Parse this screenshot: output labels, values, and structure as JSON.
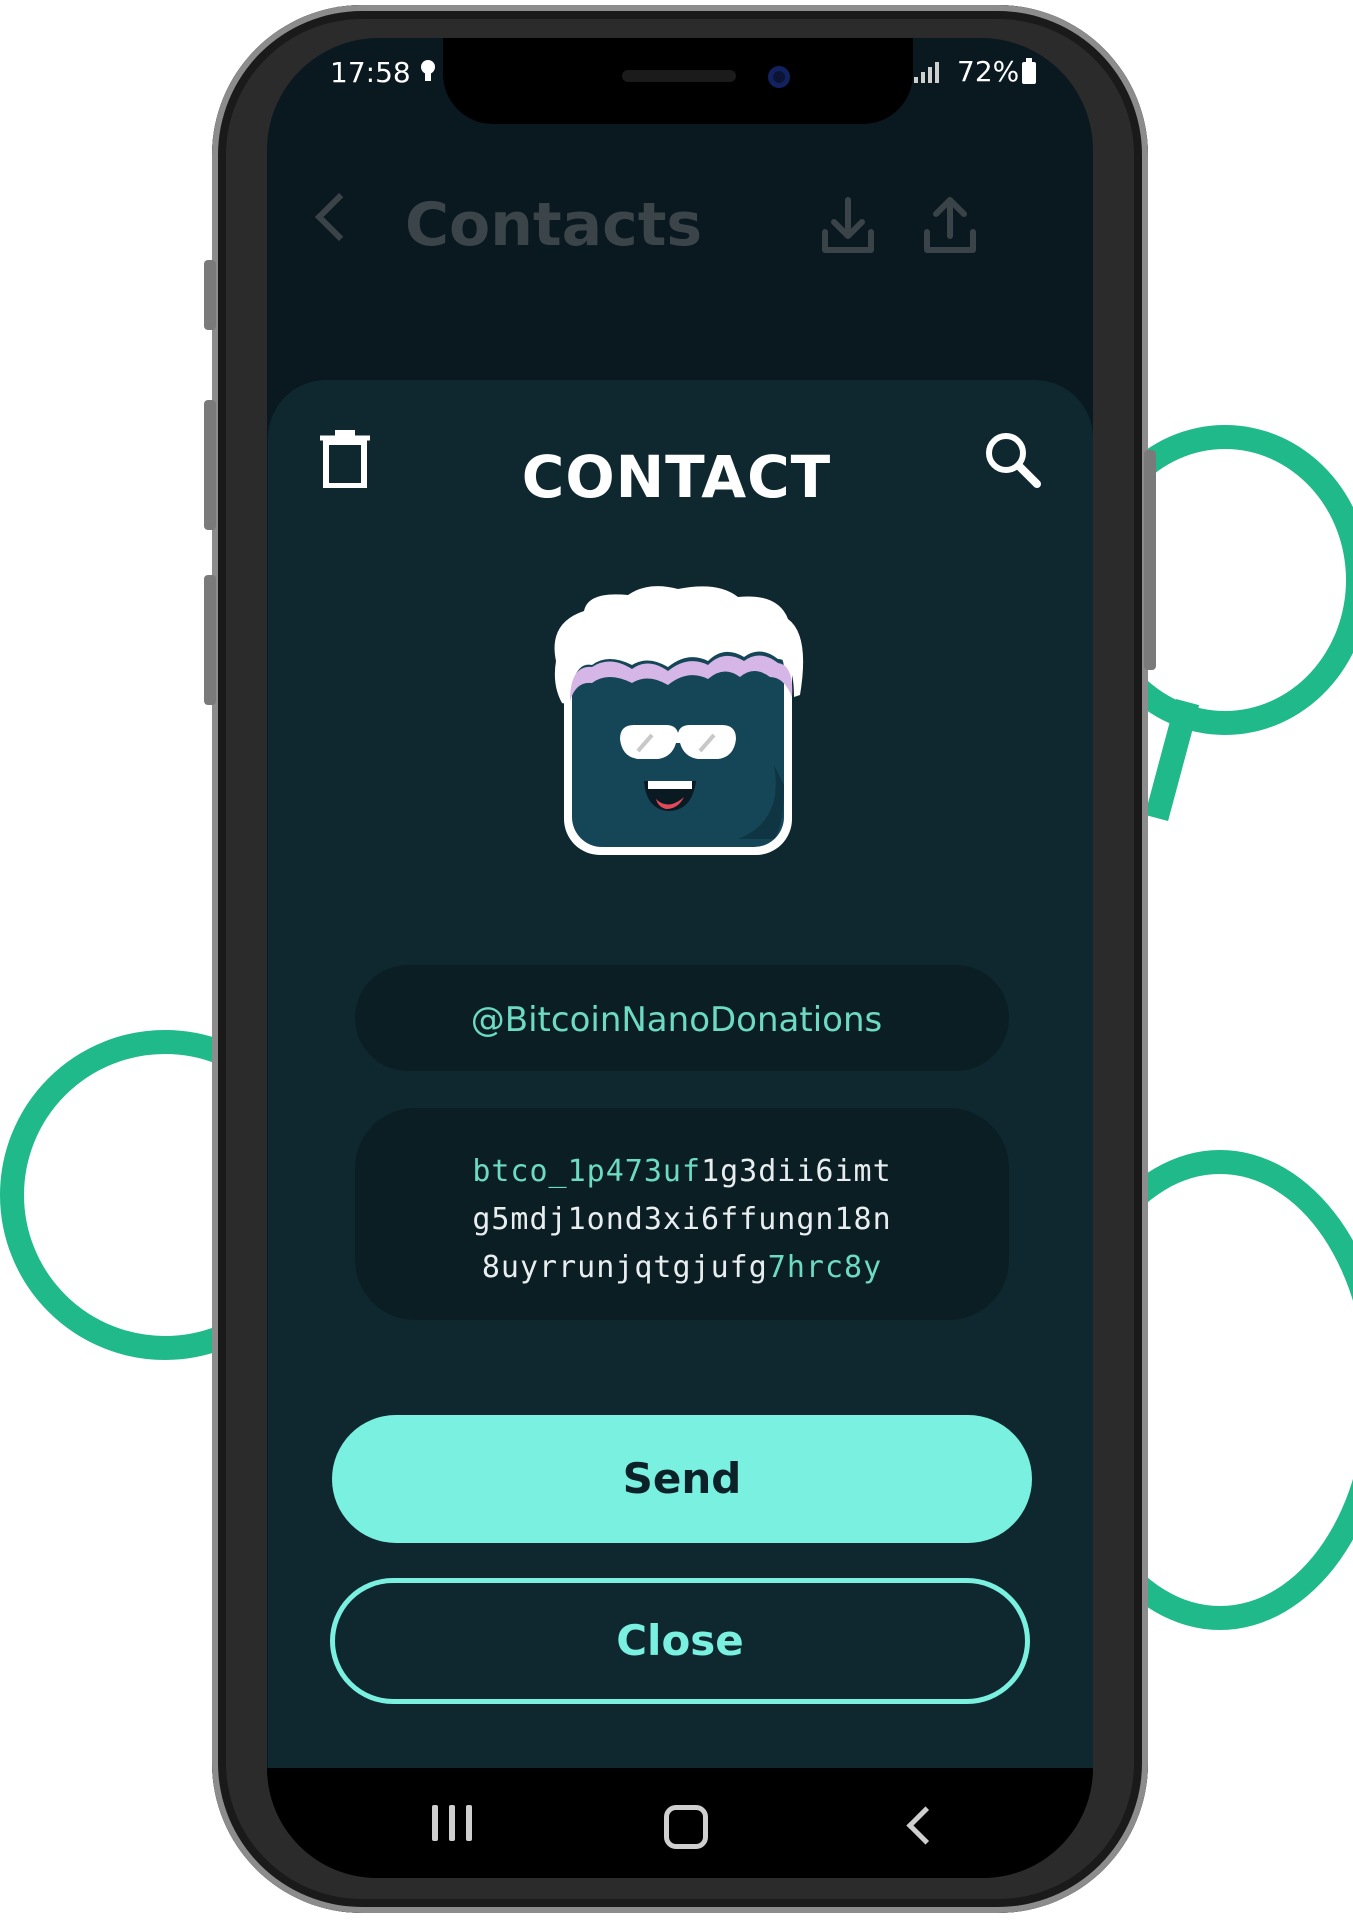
{
  "status_bar": {
    "time": "17:58",
    "battery": "72%"
  },
  "background_screen": {
    "title": "Contacts",
    "icons": [
      "back-chevron-icon",
      "download-icon",
      "upload-icon"
    ]
  },
  "modal": {
    "title": "CONTACT",
    "handle": "@BitcoinNanoDonations",
    "address": {
      "line1_highlight": "btco_1p473uf",
      "line1_rest": "1g3dii6imt",
      "line2": "g5mdj1ond3xi6ffungn18n",
      "line3_rest": "8uyrrunjqtgjufg",
      "line3_highlight": "7hrc8y"
    },
    "send_label": "Send",
    "close_label": "Close"
  },
  "colors": {
    "accent": "#7af0e0",
    "modal_bg": "#0f2830",
    "ring": "#20b98a"
  }
}
